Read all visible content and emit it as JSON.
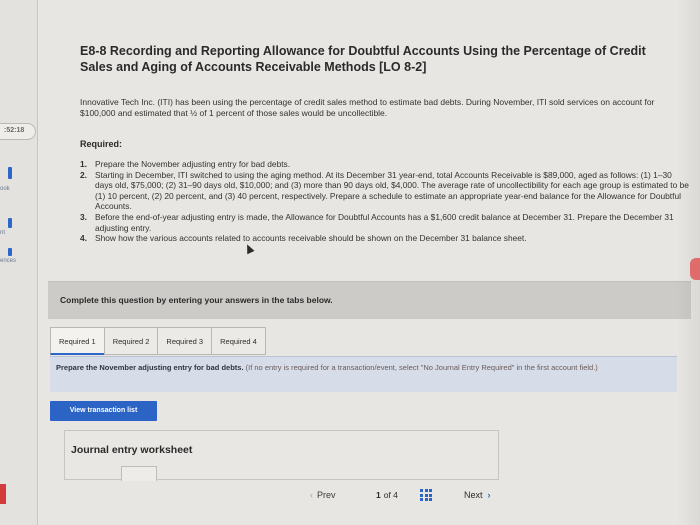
{
  "sidebar": {
    "timer": ":52:18",
    "items": [
      "ook",
      "nt",
      "ences"
    ]
  },
  "problem": {
    "title": "E8-8 Recording and Reporting Allowance for Doubtful Accounts Using the Percentage of Credit Sales and Aging of Accounts Receivable Methods [LO 8-2]",
    "intro": "Innovative Tech Inc. (ITI) has been using the percentage of credit sales method to estimate bad debts. During November, ITI sold services on account for $100,000 and estimated that ½ of 1 percent of those sales would be uncollectible.",
    "required_heading": "Required:",
    "requirements": [
      {
        "num": "1.",
        "text": "Prepare the November adjusting entry for bad debts."
      },
      {
        "num": "2.",
        "text": "Starting in December, ITI switched to using the aging method. At its December 31 year-end, total Accounts Receivable is $89,000, aged as follows: (1) 1–30 days old, $75,000; (2) 31–90 days old, $10,000; and (3) more than 90 days old, $4,000. The average rate of uncollectibility for each age group is estimated to be (1) 10 percent, (2) 20 percent, and (3) 40 percent, respectively. Prepare a schedule to estimate an appropriate year-end balance for the Allowance for Doubtful Accounts."
      },
      {
        "num": "3.",
        "text": "Before the end-of-year adjusting entry is made, the Allowance for Doubtful Accounts has a $1,600 credit balance at December 31. Prepare the December 31 adjusting entry."
      },
      {
        "num": "4.",
        "text": "Show how the various accounts related to accounts receivable should be shown on the December 31 balance sheet."
      }
    ]
  },
  "answer_panel": {
    "instruction": "Complete this question by entering your answers in the tabs below.",
    "tabs": [
      "Required 1",
      "Required 2",
      "Required 3",
      "Required 4"
    ],
    "active_tab": 0,
    "prompt_main": "Prepare the November adjusting entry for bad debts.",
    "prompt_note": "(If no entry is required for a transaction/event, select \"No Journal Entry Required\" in the first account field.)",
    "view_button": "View transaction list",
    "worksheet_title": "Journal entry worksheet"
  },
  "footer": {
    "prev": "Prev",
    "page_current": "1",
    "page_of": "of 4",
    "next": "Next"
  },
  "colors": {
    "accent": "#2b64c4",
    "background": "#e8e6e2"
  }
}
